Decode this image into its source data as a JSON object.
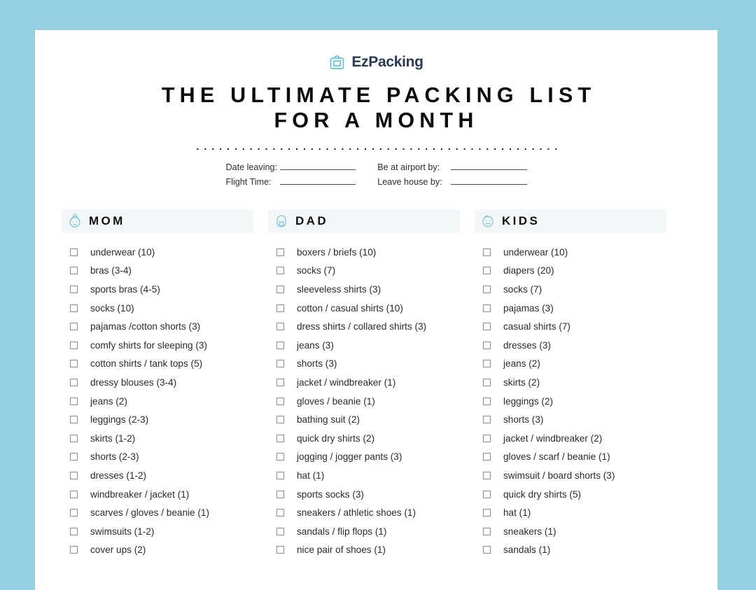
{
  "brand": {
    "icon": "suitcase-icon",
    "name": "EzPacking"
  },
  "title": {
    "line1": "THE ULTIMATE PACKING LIST",
    "line2": "FOR A MONTH"
  },
  "trip_fields": [
    {
      "label": "Date leaving:",
      "value": ""
    },
    {
      "label": "Be at airport by:",
      "value": ""
    },
    {
      "label": "Flight Time:",
      "value": ""
    },
    {
      "label": "Leave house by:",
      "value": ""
    }
  ],
  "columns": [
    {
      "id": "mom",
      "title": "MOM",
      "icon": "mom-face-icon",
      "items": [
        "underwear (10)",
        "bras (3-4)",
        "sports bras (4-5)",
        "socks (10)",
        "pajamas /cotton shorts (3)",
        "comfy shirts for sleeping (3)",
        "cotton shirts / tank tops (5)",
        "dressy blouses (3-4)",
        "jeans (2)",
        "leggings (2-3)",
        "skirts (1-2)",
        "shorts (2-3)",
        "dresses (1-2)",
        "windbreaker / jacket (1)",
        "scarves / gloves / beanie (1)",
        "swimsuits (1-2)",
        "cover ups (2)"
      ]
    },
    {
      "id": "dad",
      "title": "DAD",
      "icon": "dad-face-icon",
      "items": [
        "boxers / briefs (10)",
        "socks (7)",
        "sleeveless shirts (3)",
        "cotton / casual shirts (10)",
        "dress shirts / collared shirts (3)",
        "jeans (3)",
        "shorts (3)",
        "jacket / windbreaker (1)",
        "gloves / beanie (1)",
        "bathing suit (2)",
        "quick dry shirts (2)",
        "jogging / jogger pants (3)",
        "hat (1)",
        "sports socks (3)",
        "sneakers / athletic shoes (1)",
        "sandals / flip flops (1)",
        "nice pair of shoes (1)"
      ]
    },
    {
      "id": "kids",
      "title": "KIDS",
      "icon": "kid-face-icon",
      "items": [
        "underwear (10)",
        "diapers (20)",
        "socks (7)",
        "pajamas (3)",
        "casual shirts (7)",
        "dresses (3)",
        "jeans (2)",
        "skirts (2)",
        "leggings (2)",
        "shorts (3)",
        "jacket / windbreaker (2)",
        "gloves / scarf / beanie (1)",
        "swimsuit / board shorts (3)",
        "quick dry shirts (5)",
        "hat (1)",
        "sneakers (1)",
        "sandals (1)"
      ]
    }
  ],
  "colors": {
    "page_background": "#95d0e3",
    "sheet": "#ffffff",
    "accent_blue": "#6cc2de",
    "brand_text": "#2b3a55",
    "header_band": "#f4f7f8",
    "text": "#2b2b2b",
    "checkbox_border": "#8e8e8e"
  }
}
